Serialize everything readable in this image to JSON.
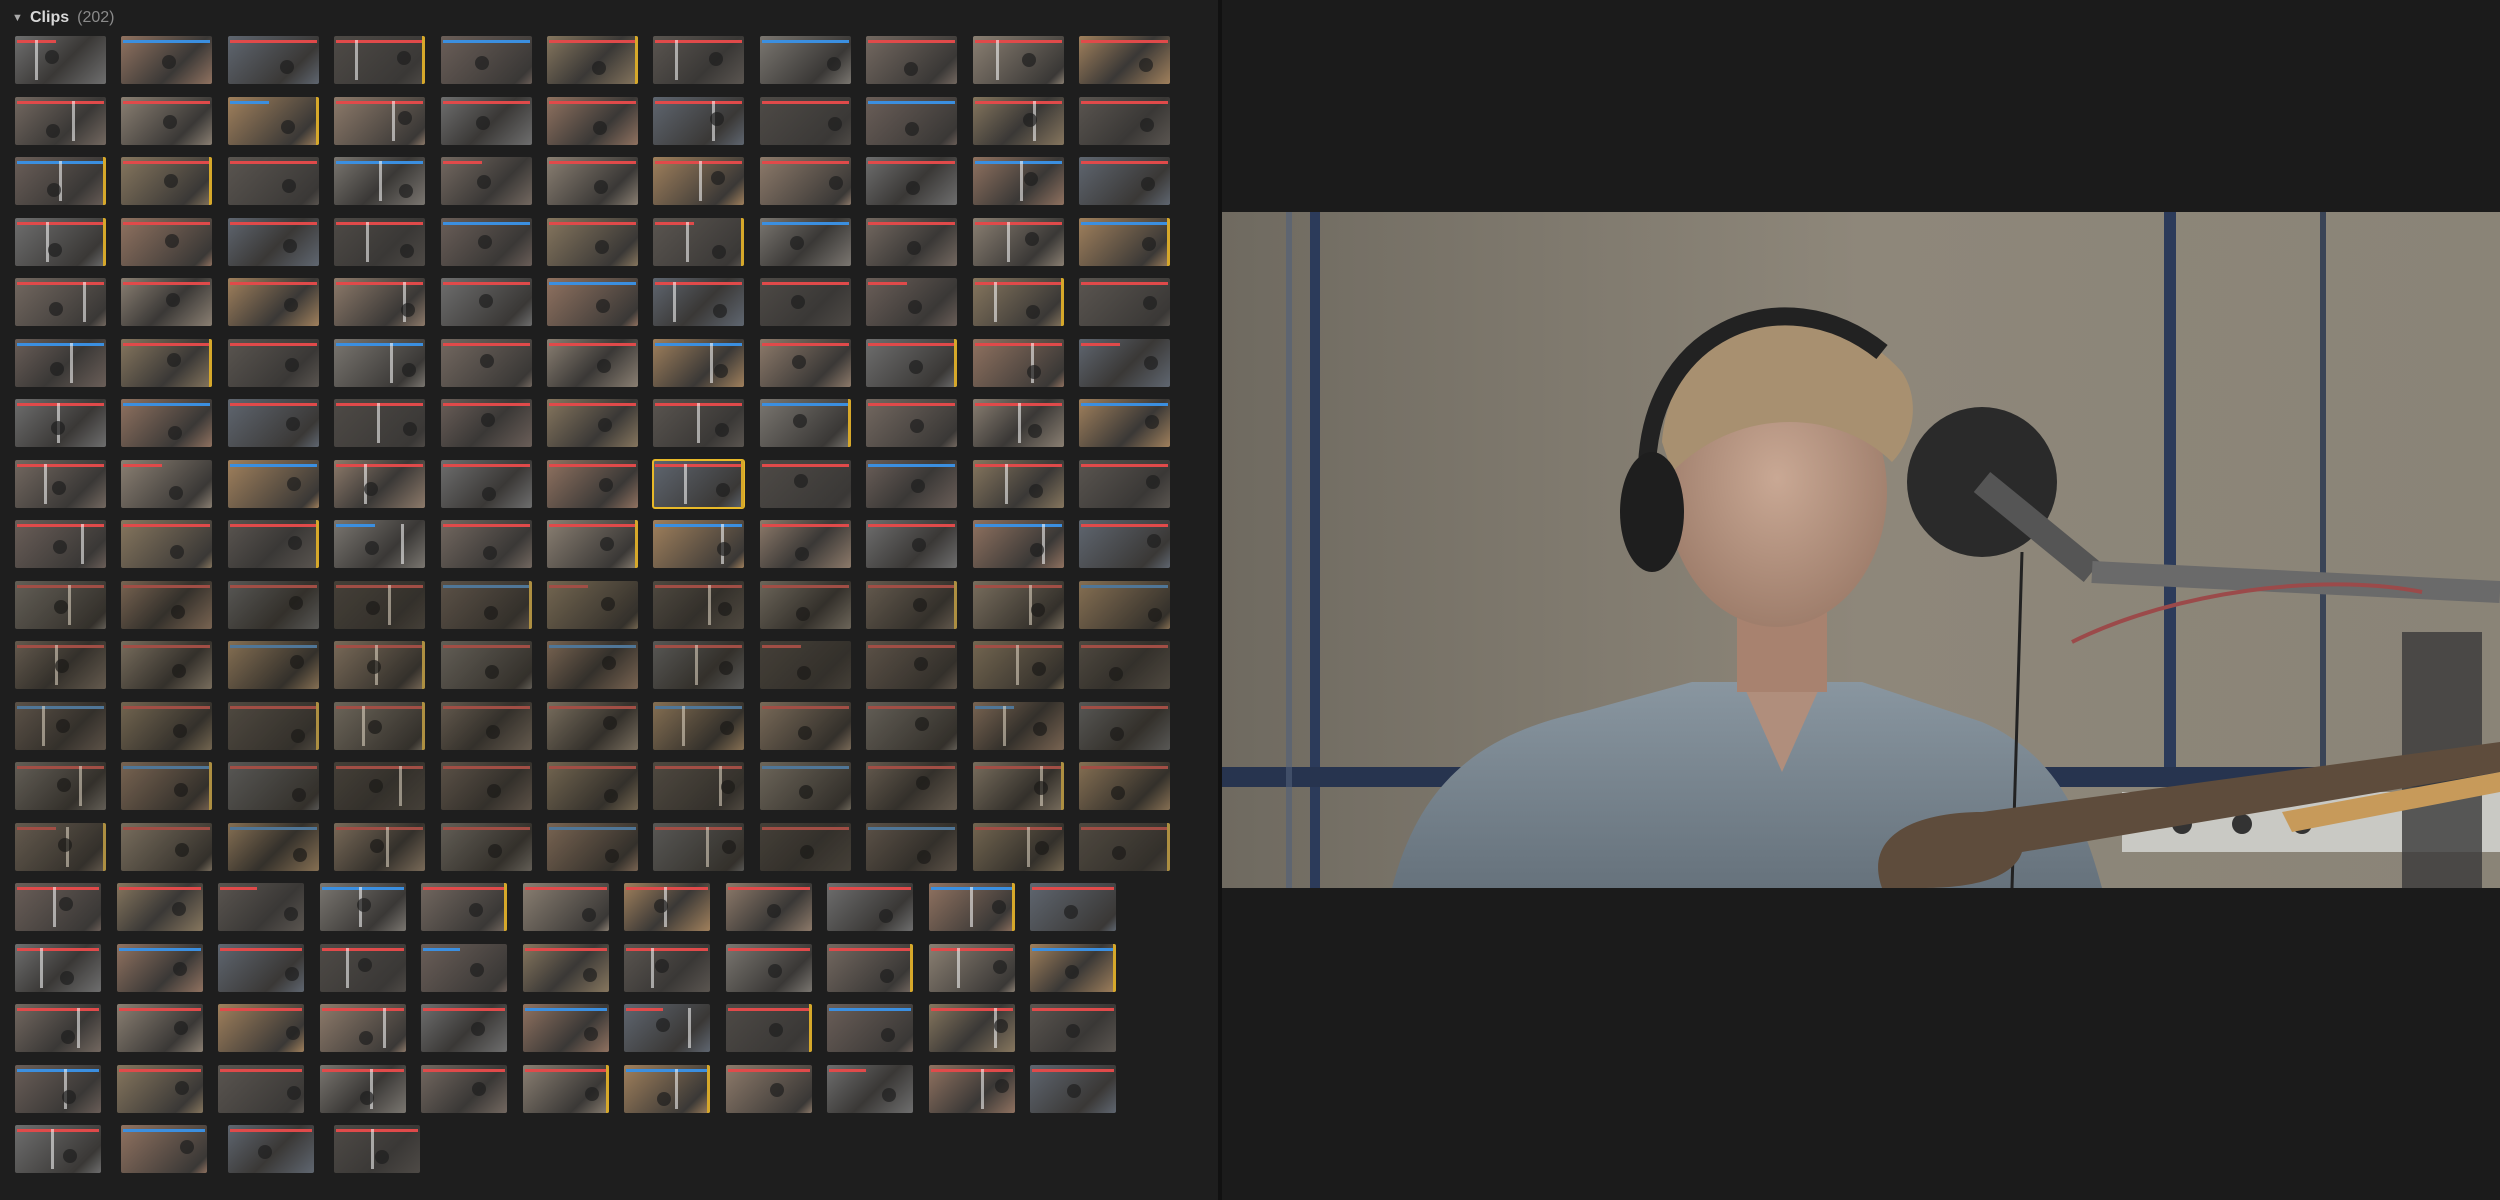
{
  "browser": {
    "title": "Clips",
    "count": "(202)",
    "disclosure_icon": "triangle-down-icon"
  },
  "viewer": {
    "frame": "video-frame"
  },
  "colors": {
    "selection": "#e8b928",
    "rating_red": "#e04a4a",
    "keyword_blue": "#3b8fe0",
    "analysis_green": "#4fc36e"
  }
}
